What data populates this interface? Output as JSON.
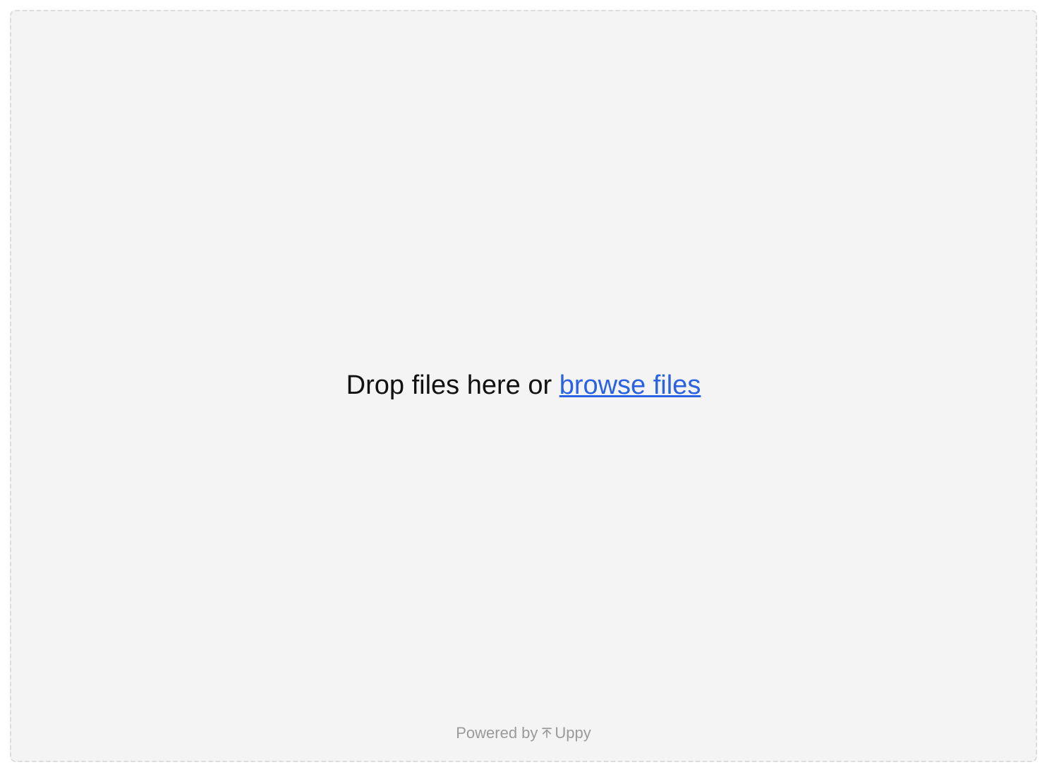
{
  "dropzone": {
    "prefix_text": "Drop files here or ",
    "browse_link_text": "browse files"
  },
  "footer": {
    "powered_by_text": "Powered by",
    "brand_name": "Uppy"
  },
  "colors": {
    "link": "#2962e2",
    "border": "#dcdcdc",
    "bg": "#f4f4f4",
    "muted": "#9a9a9a"
  }
}
